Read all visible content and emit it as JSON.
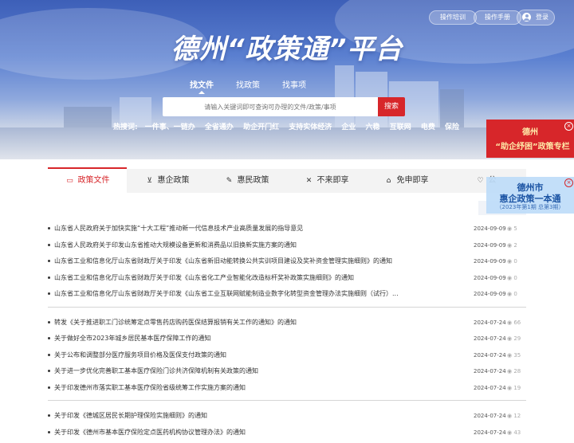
{
  "header": {
    "btn_training": "操作培训",
    "btn_manual": "操作手册",
    "btn_login": "登录",
    "title": "德州“政策通”平台"
  },
  "search": {
    "tabs": [
      "找文件",
      "找政策",
      "找事项"
    ],
    "placeholder": "请输入关键词即可查询可办理的文件/政策/事项",
    "button": "搜索",
    "hot_label": "热搜词:",
    "hot_words": [
      "一件事、一链办",
      "全省通办",
      "助企开门红",
      "支持实体经济",
      "企业",
      "六稳",
      "互联网",
      "电费",
      "保险"
    ]
  },
  "banners": {
    "b1_line1": "德州",
    "b1_line2": "“助企纾困”政策专栏",
    "b2_line1": "德州市",
    "b2_line2": "惠企政策一本通",
    "b2_line3": "（2023年第1期 总第3期）",
    "close": "×"
  },
  "tabs": [
    {
      "label": "政策文件",
      "icon": "folder-icon"
    },
    {
      "label": "惠企政策",
      "icon": "cart-icon"
    },
    {
      "label": "惠民政策",
      "icon": "edit-icon"
    },
    {
      "label": "不来即享",
      "icon": "close-x-icon"
    },
    {
      "label": "免申即享",
      "icon": "bank-icon"
    },
    {
      "label": "公",
      "icon": "heart-icon"
    }
  ],
  "groups": [
    [
      {
        "title": "山东省人民政府关于加快实施“十大工程”推动新一代信息技术产业高质量发展的指导意见",
        "date": "2024-09-09",
        "views": "5"
      },
      {
        "title": "山东省人民政府关于印发山东省推动大规模设备更新和消费品以旧换新实施方案的通知",
        "date": "2024-09-09",
        "views": "2"
      },
      {
        "title": "山东省工业和信息化厅山东省财政厅关于印发《山东省新旧动能转换公共实训项目建设及奖补资金管理实施细则》的通知",
        "date": "2024-09-09",
        "views": "0"
      },
      {
        "title": "山东省工业和信息化厅山东省财政厅关于印发《山东省化工产业智能化改造标杆奖补政策实施细则》的通知",
        "date": "2024-09-09",
        "views": "0"
      },
      {
        "title": "山东省工业和信息化厅山东省财政厅关于印发《山东省工业互联网赋能制造业数字化转型资金管理办法实施细则（试行）...",
        "date": "2024-09-09",
        "views": "0"
      }
    ],
    [
      {
        "title": "转发《关于推进职工门诊统筹定点零售药店购药医保结算报销有关工作的通知》的通知",
        "date": "2024-07-24",
        "views": "66"
      },
      {
        "title": "关于做好全市2023年城乡居民基本医疗保障工作的通知",
        "date": "2024-07-24",
        "views": "29"
      },
      {
        "title": "关于公布和调整部分医疗服务项目价格及医保支付政策的通知",
        "date": "2024-07-24",
        "views": "35"
      },
      {
        "title": "关于进一步优化完善职工基本医疗保险门诊共济保障机制有关政策的通知",
        "date": "2024-07-24",
        "views": "28"
      },
      {
        "title": "关于印发德州市落实职工基本医疗保险省级统筹工作实施方案的通知",
        "date": "2024-07-24",
        "views": "19"
      }
    ],
    [
      {
        "title": "关于印发《德城区居民长期护理保险实施细则》的通知",
        "date": "2024-07-24",
        "views": "12"
      },
      {
        "title": "关于印发《德州市基本医疗保险定点医药机构协议管理办法》的通知",
        "date": "2024-07-24",
        "views": "43"
      }
    ]
  ]
}
